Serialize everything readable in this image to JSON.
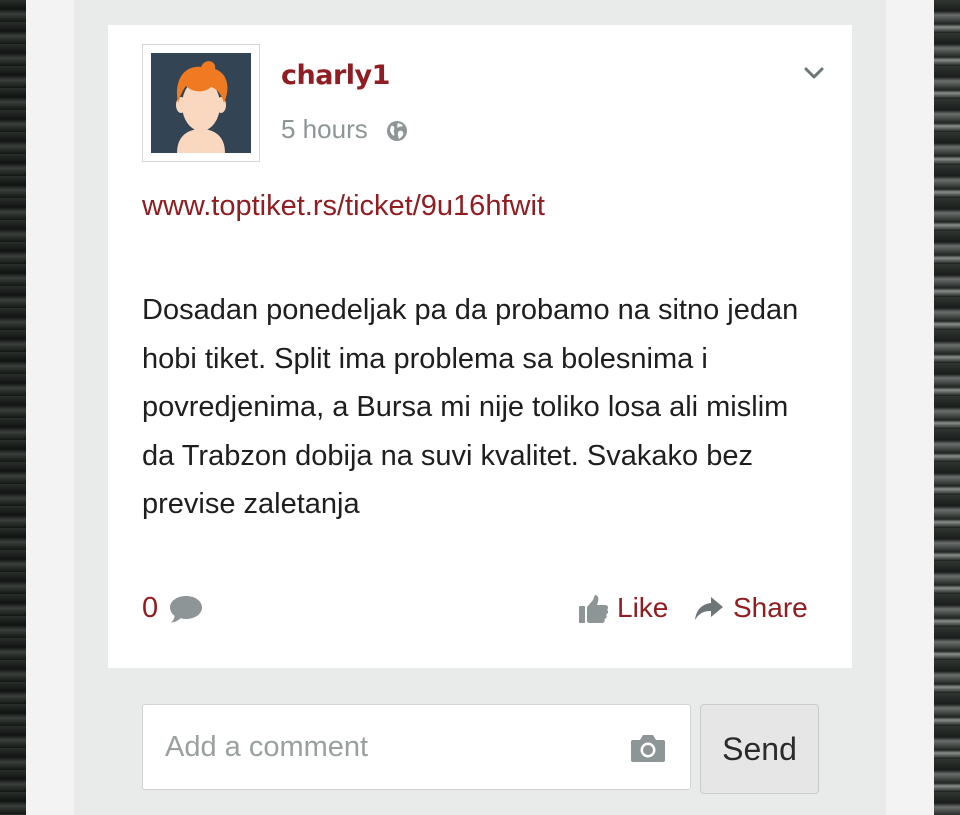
{
  "post": {
    "username": "charly1",
    "time": "5 hours",
    "link": "www.toptiket.rs/ticket/9u16hfwit",
    "text": "Dosadan ponedeljak pa da probamo na sitno jedan hobi tiket. Split ima problema sa bolesnima i povredjenima, a Bursa mi nije toliko losa ali mislim da Trabzon dobija na suvi kvalitet. Svakako bez previse zaletanja",
    "comment_count": "0",
    "like_label": "Like",
    "share_label": "Share"
  },
  "comment_form": {
    "placeholder": "Add a comment",
    "send_label": "Send"
  },
  "icons": {
    "visibility": "globe-icon",
    "menu": "chevron-down-icon",
    "comments": "comment-bubble-icon",
    "like": "thumbs-up-icon",
    "share": "share-arrow-icon",
    "attach": "camera-icon"
  },
  "colors": {
    "accent": "#8f1d21",
    "muted": "#8e9596",
    "avatar_bg": "#334455",
    "avatar_hair": "#f07a22",
    "avatar_skin": "#f9d8bf"
  }
}
